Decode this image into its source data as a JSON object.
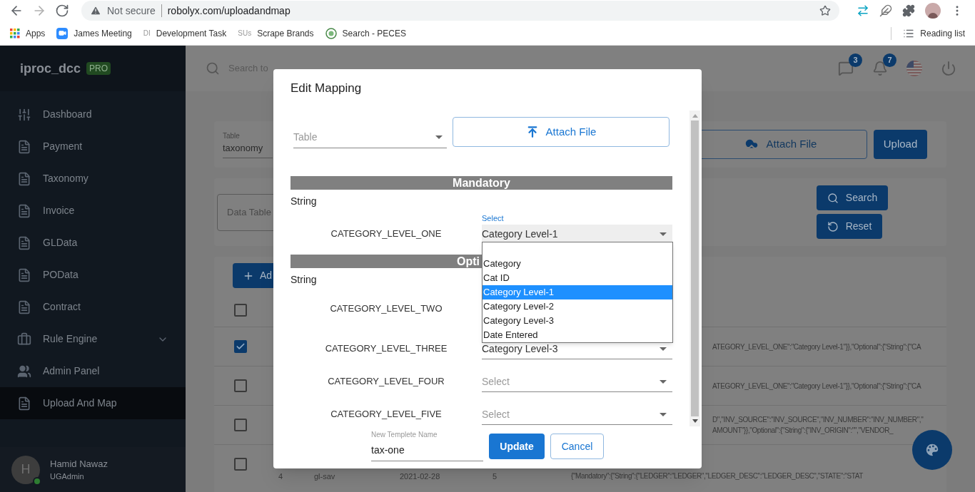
{
  "browser": {
    "nav": [
      {
        "kind": "back",
        "disabled": false
      },
      {
        "kind": "forward",
        "disabled": true
      },
      {
        "kind": "reload",
        "disabled": false
      }
    ],
    "security": "Not secure",
    "url": "robolyx.com/uploadandmap",
    "bookmarks": [
      {
        "kind": "apps",
        "label": "Apps"
      },
      {
        "kind": "video",
        "label": "James Meeting"
      },
      {
        "kind": "letters",
        "favicon": "DI",
        "label": "Development Task"
      },
      {
        "kind": "letters",
        "favicon": "SUs",
        "label": "Scrape Brands"
      },
      {
        "kind": "emblem",
        "label": "Search - PECES"
      }
    ],
    "reading_list": "Reading list"
  },
  "sidebar": {
    "brand": "iproc_dcc",
    "badge": "PRO",
    "items": [
      {
        "kind": "sliders",
        "label": "Dashboard",
        "selected": false,
        "submenu": false
      },
      {
        "kind": "document",
        "label": "Payment",
        "selected": false,
        "submenu": false
      },
      {
        "kind": "document",
        "label": "Taxonomy",
        "selected": false,
        "submenu": false
      },
      {
        "kind": "document",
        "label": "Invoice",
        "selected": false,
        "submenu": false
      },
      {
        "kind": "document",
        "label": "GLData",
        "selected": false,
        "submenu": false
      },
      {
        "kind": "document",
        "label": "POData",
        "selected": false,
        "submenu": false
      },
      {
        "kind": "document",
        "label": "Contract",
        "selected": false,
        "submenu": false
      },
      {
        "kind": "briefcase",
        "label": "Rule Engine",
        "selected": false,
        "submenu": true
      },
      {
        "kind": "people",
        "label": "Admin Panel",
        "selected": false,
        "submenu": false
      },
      {
        "kind": "document",
        "label": "Upload And Map",
        "selected": true,
        "submenu": false
      }
    ],
    "user": {
      "initial": "H",
      "name": "Hamid Nawaz",
      "role": "UGAdmin",
      "online": true
    }
  },
  "header": {
    "search_placeholder": "Search to",
    "messages_badge": "3",
    "notifications_badge": "7"
  },
  "upload_card": {
    "table_label": "Table",
    "table_value": "taxonomy",
    "attach": "Attach File",
    "upload": "Upload"
  },
  "filter_card": {
    "field_placeholder": "Data Table",
    "search": "Search",
    "reset": "Reset"
  },
  "table": {
    "add": "Ad",
    "header_checked": false,
    "rows": [
      {
        "kind": "partial",
        "checked": true,
        "lines": [
          "ATEGORY_LEVEL_ONE\":\"Category Level-1\"}},\"Optional\":{\"String\":{\"CA"
        ]
      },
      {
        "kind": "partial",
        "checked": false,
        "lines": [
          "ATEGORY_LEVEL_ONE\":\"Category Level-1\"}},\"Optional\":{\"String\":{\"CA"
        ]
      },
      {
        "kind": "partial",
        "checked": false,
        "lines": [
          "D\",\"INV_SOURCE\":\"INV_SOURCE\",\"INV_NUMBER\":\"INV_NUMBER\",\"",
          "AMOUNT\"}},\"Optional\":{\"String\":{\"INV_ORIGIN\":\"\",\"VENDOR_"
        ]
      },
      {
        "kind": "full",
        "checked": false,
        "number": "4",
        "name": "gl-sav",
        "date": "2021-02-28",
        "count": "5",
        "lines": [
          "{\"Mandatory\":{\"String\":{\"LEDGER\":\"LEDGER\",\"LEDGER_DESC\":\"LEDGER_DESC\",\"STATE\":\"STAT"
        ]
      }
    ]
  },
  "modal": {
    "title": "Edit Mapping",
    "table_placeholder": "Table",
    "attach": "Attach File",
    "sections": [
      {
        "title": "Mandatory",
        "type": "String",
        "rows": [
          {
            "label": "CATEGORY_LEVEL_ONE",
            "select": {
              "label": "Select",
              "value": "Category Level-1",
              "focused": true
            }
          }
        ]
      },
      {
        "title": "Opti",
        "type": "String",
        "rows": [
          {
            "label": "CATEGORY_LEVEL_TWO"
          },
          {
            "label": "CATEGORY_LEVEL_THREE",
            "select": {
              "value": "Category Level-3",
              "focused": false
            }
          },
          {
            "label": "CATEGORY_LEVEL_FOUR",
            "select": {
              "placeholder": "Select",
              "focused": false
            }
          },
          {
            "label": "CATEGORY_LEVEL_FIVE",
            "select": {
              "placeholder": "Select",
              "focused": false
            }
          }
        ]
      }
    ],
    "dropdown": [
      {
        "selected": false
      },
      {
        "label": "Category",
        "selected": false
      },
      {
        "label": "Cat ID",
        "selected": false
      },
      {
        "label": "Category Level-1",
        "selected": true
      },
      {
        "label": "Category Level-2",
        "selected": false
      },
      {
        "label": "Category Level-3",
        "selected": false
      },
      {
        "label": "Date Entered",
        "selected": false
      }
    ],
    "template_label": "New Templete Name",
    "template_value": "tax-one",
    "update": "Update",
    "cancel": "Cancel"
  }
}
